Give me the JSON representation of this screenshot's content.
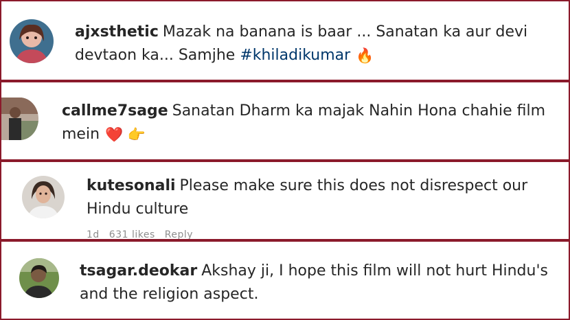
{
  "comments": [
    {
      "username": "ajxsthetic",
      "text": "Mazak na banana is baar ... Sanatan ka aur devi devtaon ka... Samjhe",
      "hashtag": "#khiladikumar",
      "emoji": "🔥"
    },
    {
      "username": "callme7sage",
      "text": "Sanatan Dharm ka majak Nahin Hona chahie film mein",
      "emoji": "❤️ 👉"
    },
    {
      "username": "kutesonali",
      "text": "Please make sure this does not disrespect our Hindu culture",
      "meta": {
        "time": "1d",
        "likes": "631 likes",
        "reply": "Reply"
      }
    },
    {
      "username": "tsagar.deokar",
      "text": "Akshay ji, I hope this film will not hurt Hindu's and the religion aspect."
    }
  ],
  "colors": {
    "border": "#8b1a2b",
    "hashtag": "#00376b",
    "text": "#262626"
  }
}
